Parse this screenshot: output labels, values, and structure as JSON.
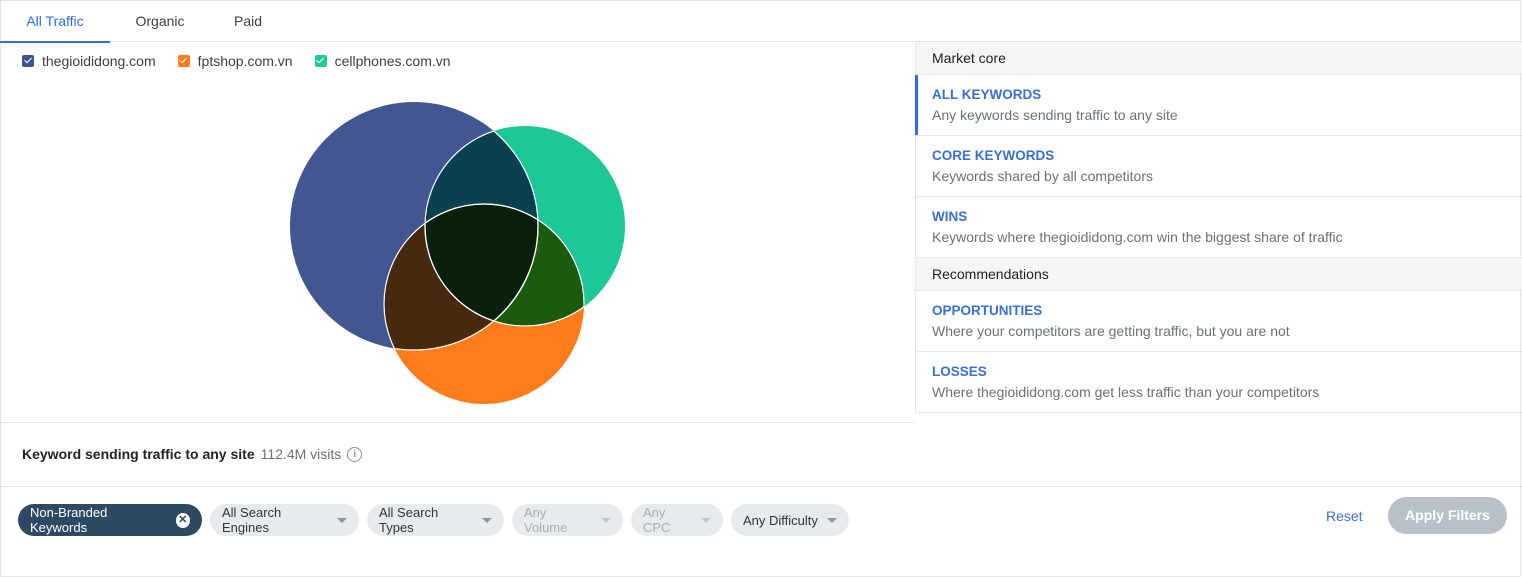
{
  "tabs": [
    {
      "label": "All Traffic",
      "active": true
    },
    {
      "label": "Organic",
      "active": false
    },
    {
      "label": "Paid",
      "active": false
    }
  ],
  "legend": [
    {
      "label": "thegioididong.com",
      "color": "#3f5490",
      "checked": true
    },
    {
      "label": "fptshop.com.vn",
      "color": "#ff7d1e",
      "checked": true
    },
    {
      "label": "cellphones.com.vn",
      "color": "#20c997",
      "checked": true
    }
  ],
  "venn_colors": {
    "a": "#425792",
    "b": "#ff7c1d",
    "c": "#1ec896",
    "ab": "#452a0f",
    "ac": "#0a4050",
    "bc": "#1c5a0e",
    "abc": "#08200c"
  },
  "right_panel": {
    "market_core_header": "Market core",
    "items": [
      {
        "title": "ALL KEYWORDS",
        "desc": "Any keywords sending traffic to any site",
        "active": true
      },
      {
        "title": "CORE KEYWORDS",
        "desc": "Keywords shared by all competitors",
        "active": false
      },
      {
        "title": "WINS",
        "desc": "Keywords where thegioididong.com win the biggest share of traffic",
        "active": false
      }
    ],
    "recommendations_header": "Recommendations",
    "rec_items": [
      {
        "title": "OPPORTUNITIES",
        "desc": "Where your competitors are getting traffic, but you are not"
      },
      {
        "title": "LOSSES",
        "desc": "Where thegioididong.com get less traffic than your competitors"
      }
    ]
  },
  "summary": {
    "title": "Keyword sending traffic to any site",
    "visits": "112.4M visits",
    "info_icon": "i"
  },
  "filters": {
    "branded": "Non-Branded Keywords",
    "remove_icon": "✕",
    "engines": "All Search Engines",
    "types": "All Search Types",
    "volume": "Any Volume",
    "cpc": "Any CPC",
    "difficulty": "Any Difficulty",
    "reset": "Reset",
    "apply": "Apply Filters"
  }
}
